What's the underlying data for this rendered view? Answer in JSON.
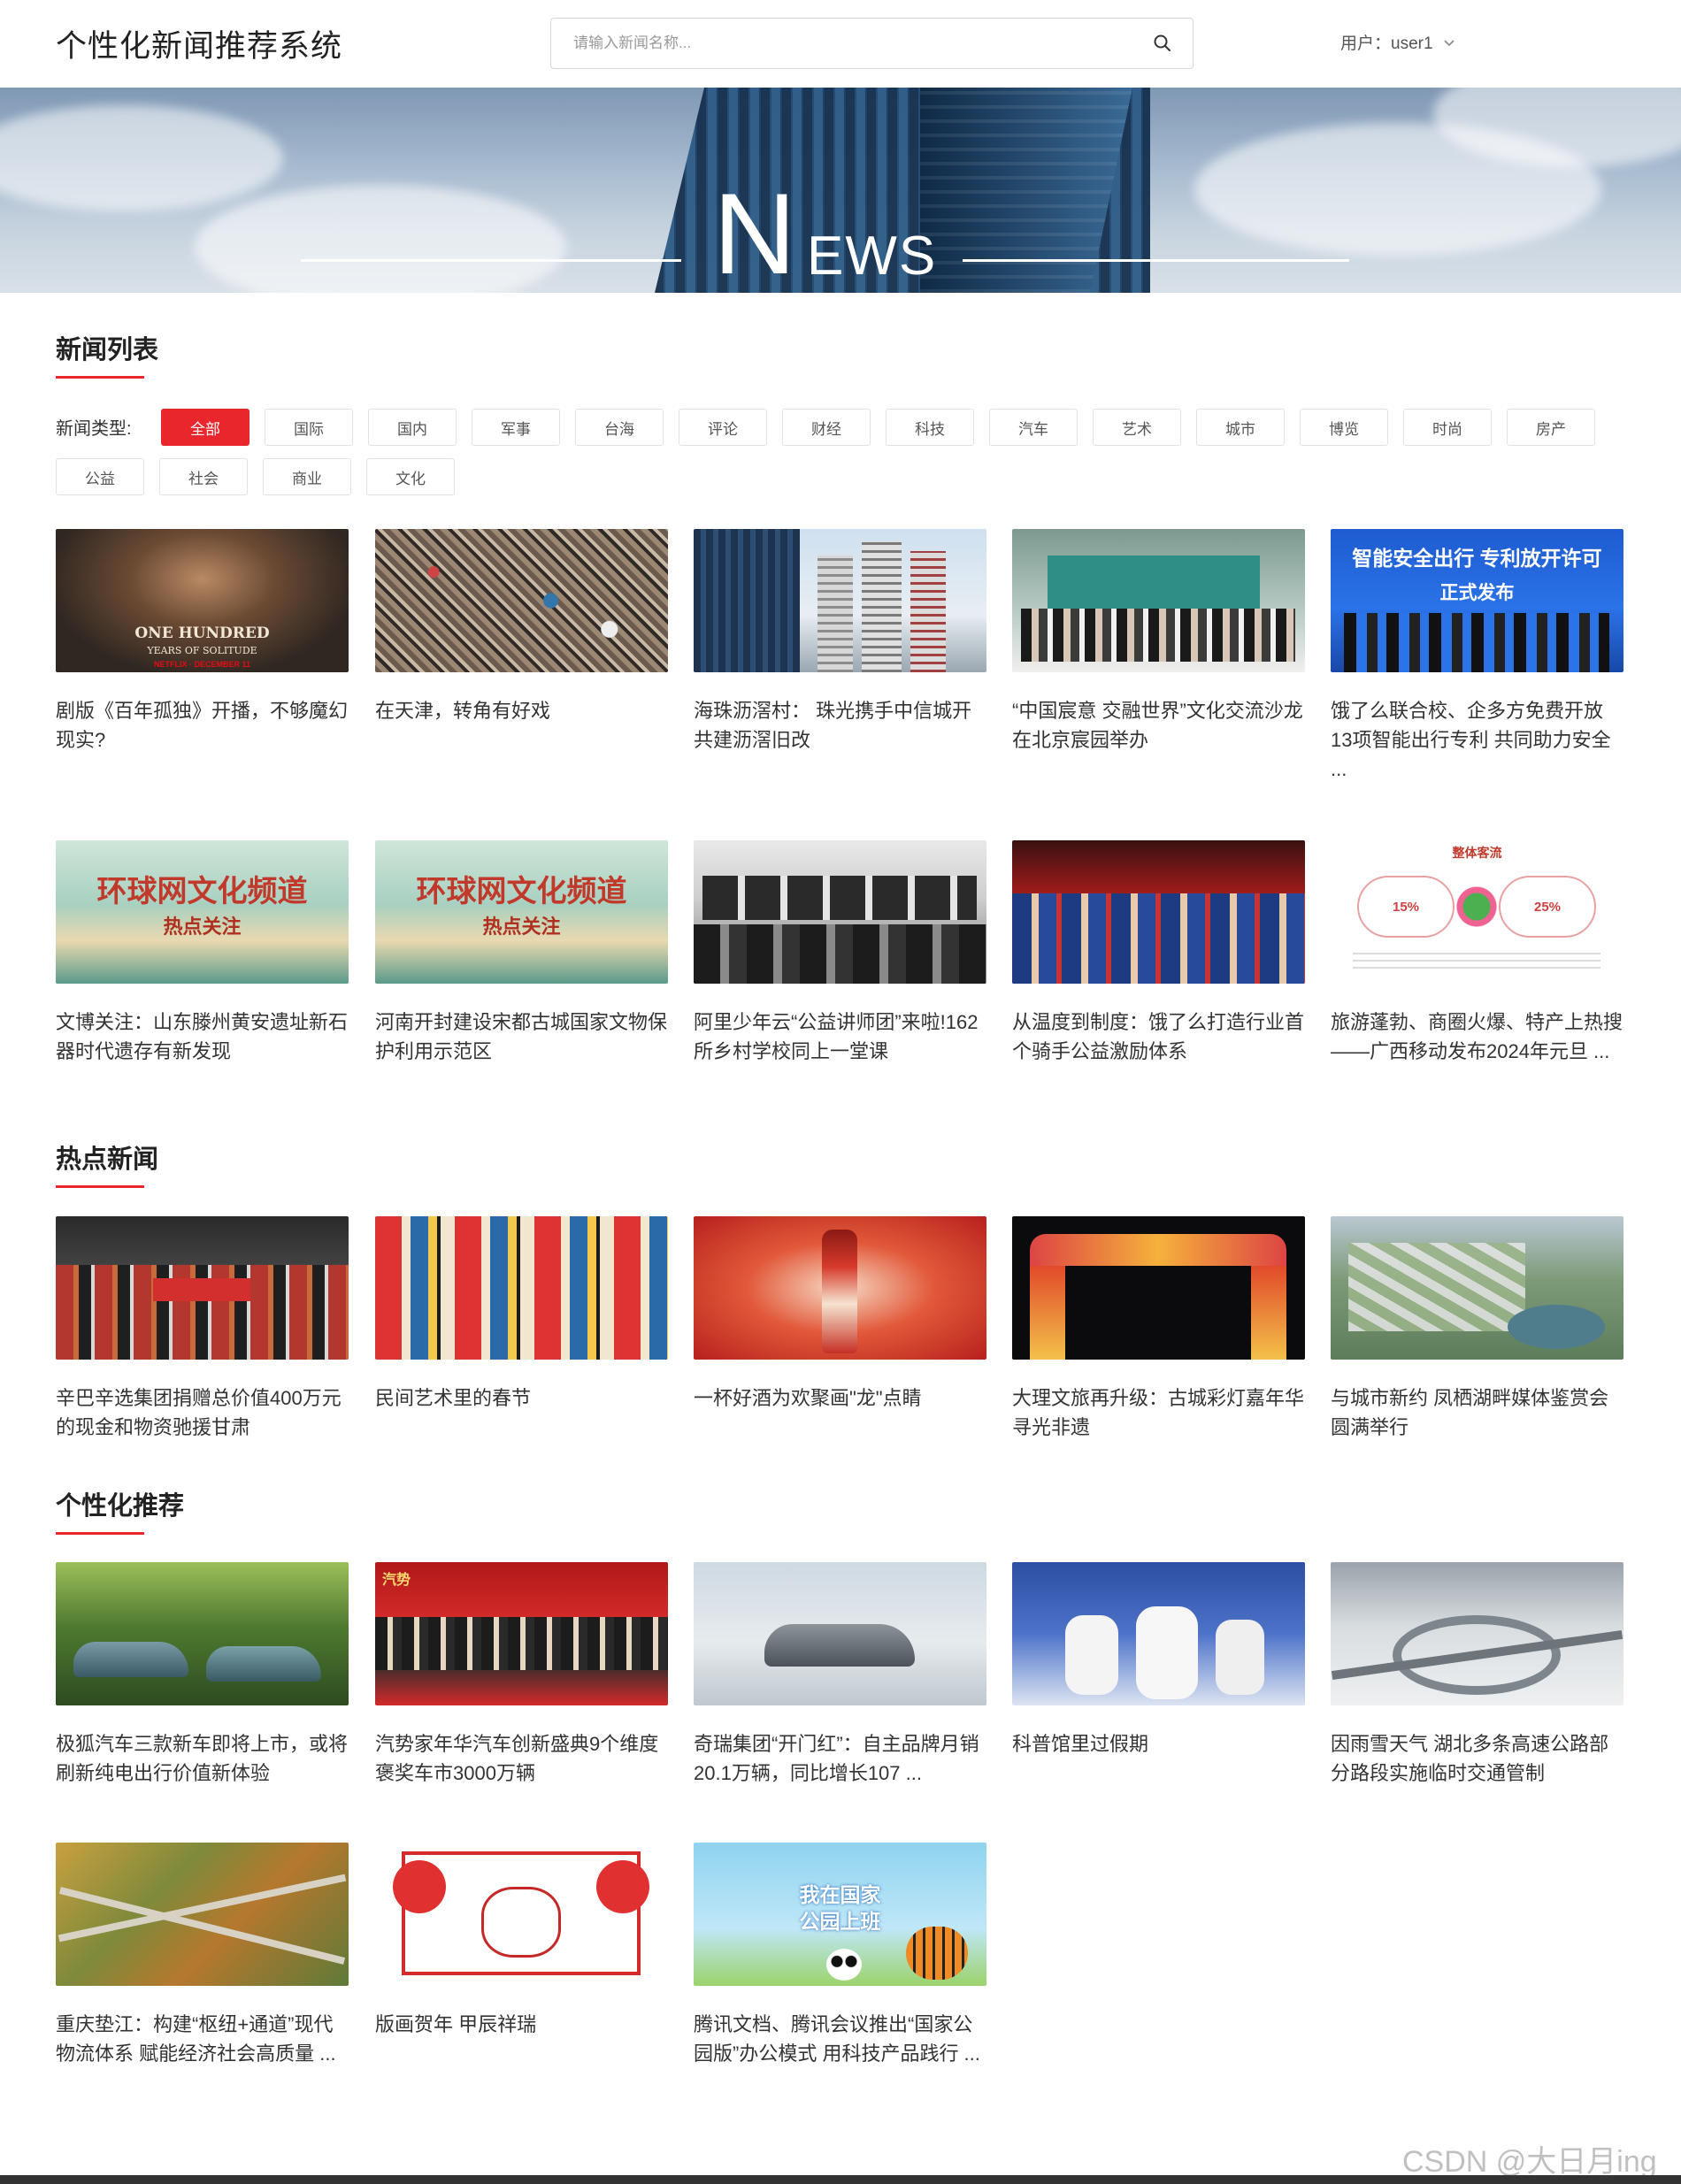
{
  "header": {
    "title": "个性化新闻推荐系统",
    "search_placeholder": "请输入新闻名称...",
    "user_label": "用户：user1"
  },
  "banner": {
    "n": "N",
    "ews": "EWS"
  },
  "news_list": {
    "title": "新闻列表",
    "filter_label": "新闻类型:",
    "active_tag": "全部",
    "tags": [
      "全部",
      "国际",
      "国内",
      "军事",
      "台海",
      "评论",
      "财经",
      "科技",
      "汽车",
      "艺术",
      "城市",
      "博览",
      "时尚",
      "房产",
      "公益",
      "社会",
      "商业",
      "文化"
    ],
    "items": [
      {
        "title": "剧版《百年孤独》开播，不够魔幻现实?"
      },
      {
        "title": "在天津，转角有好戏"
      },
      {
        "title": "海珠沥滘村： 珠光携手中信城开共建沥滘旧改"
      },
      {
        "title": "“中国宸意 交融世界”文化交流沙龙在北京宸园举办"
      },
      {
        "title": "饿了么联合校、企多方免费开放13项智能出行专利 共同助力安全 ..."
      },
      {
        "title": "文博关注：山东滕州黄安遗址新石器时代遗存有新发现"
      },
      {
        "title": "河南开封建设宋都古城国家文物保护利用示范区"
      },
      {
        "title": "阿里少年云“公益讲师团”来啦!162所乡村学校同上一堂课"
      },
      {
        "title": "从温度到制度：饿了么打造行业首个骑手公益激励体系"
      },
      {
        "title": "旅游蓬勃、商圈火爆、特产上热搜——广西移动发布2024年元旦 ..."
      }
    ]
  },
  "hot_news": {
    "title": "热点新闻",
    "items": [
      {
        "title": "辛巴辛选集团捐赠总价值400万元的现金和物资驰援甘肃"
      },
      {
        "title": "民间艺术里的春节"
      },
      {
        "title": "一杯好酒为欢聚画\"龙\"点睛"
      },
      {
        "title": "大理文旅再升级：古城彩灯嘉年华寻光非遗"
      },
      {
        "title": "与城市新约 凤栖湖畔媒体鉴赏会圆满举行"
      }
    ]
  },
  "recommend": {
    "title": "个性化推荐",
    "items": [
      {
        "title": "极狐汽车三款新车即将上市，或将刷新纯电出行价值新体验"
      },
      {
        "title": "汽势家年华汽车创新盛典9个维度褒奖车市3000万辆"
      },
      {
        "title": "奇瑞集团“开门红”：自主品牌月销20.1万辆，同比增长107 ..."
      },
      {
        "title": "科普馆里过假期"
      },
      {
        "title": "因雨雪天气 湖北多条高速公路部分路段实施临时交通管制"
      },
      {
        "title": "重庆垫江：构建“枢纽+通道”现代物流体系 赋能经济社会高质量 ..."
      },
      {
        "title": "版画贺年 甲辰祥瑞"
      },
      {
        "title": "腾讯文档、腾讯会议推出“国家公园版”办公模式 用科技产品践行 ..."
      }
    ]
  },
  "image_text": {
    "netflix_1": "ONE HUNDRED",
    "netflix_2": "YEARS OF SOLITUDE",
    "netflix_3": "NETFLIX · DECEMBER 11",
    "smart_1": "智能安全出行 专利放开许可",
    "smart_2": "正式发布",
    "huanqiu_1": "环球网文化频道",
    "huanqiu_2": "热点关注",
    "guangxi_title": "整体客流",
    "guangxi_p1": "15%",
    "guangxi_p2": "25%",
    "park_1": "我在国家",
    "park_2": "公园上班",
    "huodong": "汽势"
  },
  "watermark": "CSDN @大日月ing",
  "colors": {
    "accent": "#e8262c",
    "text": "#333333",
    "border": "#e2e2e2"
  }
}
